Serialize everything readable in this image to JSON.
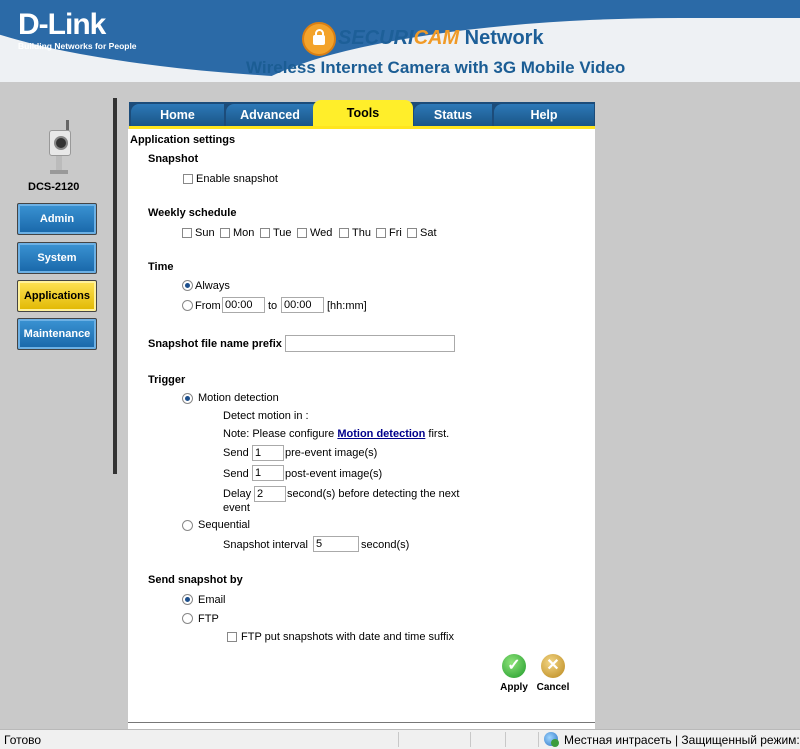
{
  "header": {
    "logo_text": "D-Link",
    "logo_tagline": "Building Networks for People",
    "brand_securi": "SECURI",
    "brand_cam": "CAM",
    "brand_network": " Network",
    "subtitle": "Wireless Internet Camera with 3G Mobile Video"
  },
  "sidebar": {
    "model": "DCS-2120",
    "items": [
      {
        "label": "Admin",
        "active": false
      },
      {
        "label": "System",
        "active": false
      },
      {
        "label": "Applications",
        "active": true
      },
      {
        "label": "Maintenance",
        "active": false
      }
    ]
  },
  "tabs": [
    {
      "label": "Home",
      "active": false
    },
    {
      "label": "Advanced",
      "active": false
    },
    {
      "label": "Tools",
      "active": true
    },
    {
      "label": "Status",
      "active": false
    },
    {
      "label": "Help",
      "active": false
    }
  ],
  "main": {
    "heading": "Application settings",
    "snapshot": {
      "section": "Snapshot",
      "enable_label": "Enable snapshot",
      "enabled": false
    },
    "schedule": {
      "section": "Weekly schedule",
      "days": [
        "Sun",
        "Mon",
        "Tue",
        "Wed",
        "Thu",
        "Fri",
        "Sat"
      ]
    },
    "time": {
      "section": "Time",
      "always_label": "Always",
      "from_label": "From",
      "from_value": "00:00",
      "to_label": "to",
      "to_value": "00:00",
      "format_hint": "[hh:mm]",
      "selected": "always"
    },
    "prefix": {
      "label": "Snapshot file name prefix",
      "value": ""
    },
    "trigger": {
      "section": "Trigger",
      "motion_label": "Motion detection",
      "detect_in_label": "Detect motion in :",
      "note_prefix": "Note: Please configure ",
      "note_link": "Motion detection",
      "note_suffix": " first.",
      "send_label": "Send",
      "pre_value": "1",
      "pre_suffix": "pre-event image(s)",
      "post_value": "1",
      "post_suffix": "post-event image(s)",
      "delay_label": "Delay",
      "delay_value": "2",
      "delay_suffix": "second(s) before detecting the next",
      "delay_suffix2": "event",
      "sequential_label": "Sequential",
      "interval_label": "Snapshot interval",
      "interval_value": "5",
      "interval_suffix": "second(s)",
      "selected": "motion"
    },
    "send_by": {
      "section": "Send snapshot by",
      "email_label": "Email",
      "ftp_label": "FTP",
      "ftp_suffix_label": "FTP put snapshots with date and time suffix",
      "selected": "email"
    },
    "apply_label": "Apply",
    "cancel_label": "Cancel"
  },
  "statusbar": {
    "left": "Готово",
    "zone": "Местная интрасеть | Защищенный режим:"
  },
  "colors": {
    "header_blue": "#2b6aa7",
    "tab_active": "#ffee2a",
    "sidebar_active": "#ffe356"
  }
}
